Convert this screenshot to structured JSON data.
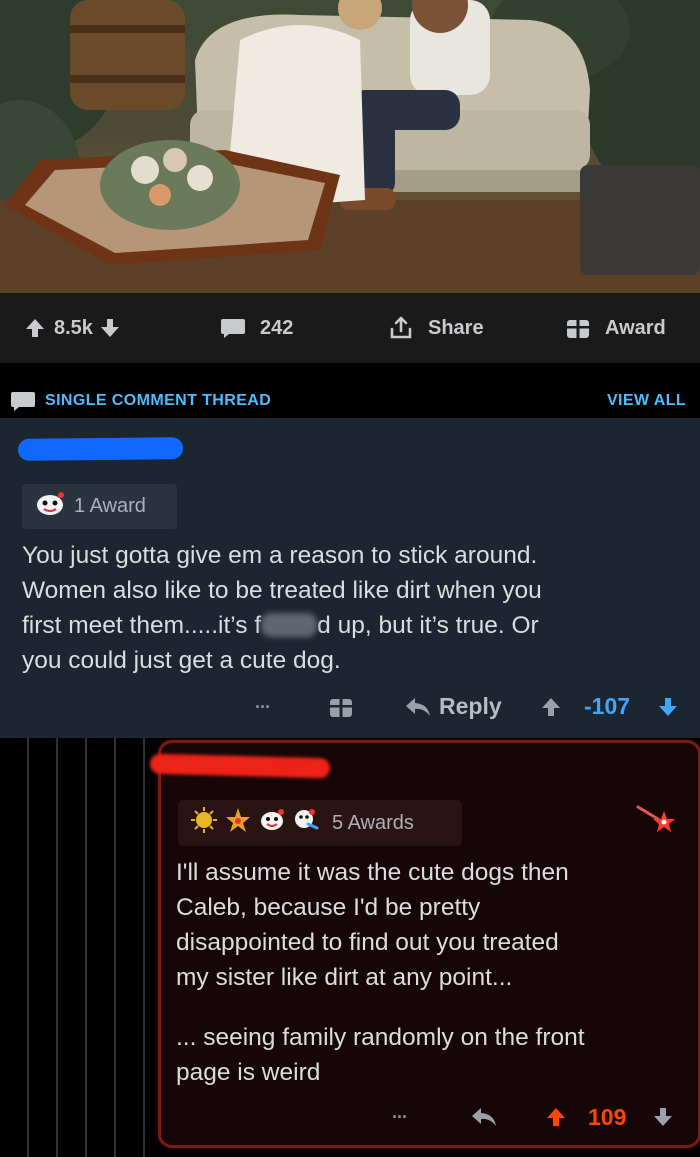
{
  "post_actions": {
    "score": "8.5k",
    "comments_count": "242",
    "share_label": "Share",
    "award_label": "Award"
  },
  "thread_header": {
    "title": "SINGLE COMMENT THREAD",
    "view_all": "VIEW ALL"
  },
  "comment1": {
    "awards": "1 Award",
    "lines": [
      "You just gotta give em a reason to stick around.",
      "Women also like to be treated like dirt when you",
      "first meet them.....it’s f",
      "d up, but it’s true.   Or",
      "you could just get a cute dog."
    ],
    "more": "...",
    "reply_label": "Reply",
    "score": "-107"
  },
  "comment2": {
    "awards": "5 Awards",
    "lines": [
      "I'll assume it was the cute dogs then",
      "Caleb, because I'd be pretty",
      "disappointed to find out you treated",
      "my sister like dirt at any point..."
    ],
    "lines2": [
      "... seeing family randomly on the front",
      "page is weird"
    ],
    "more": "...",
    "score": "109"
  },
  "colors": {
    "link_blue": "#4fbcff",
    "upvote_orange": "#ff4500",
    "downvote_blue": "#3fa6ff",
    "comment1_bg": "#1c2631",
    "comment2_border": "#7a1a10"
  }
}
